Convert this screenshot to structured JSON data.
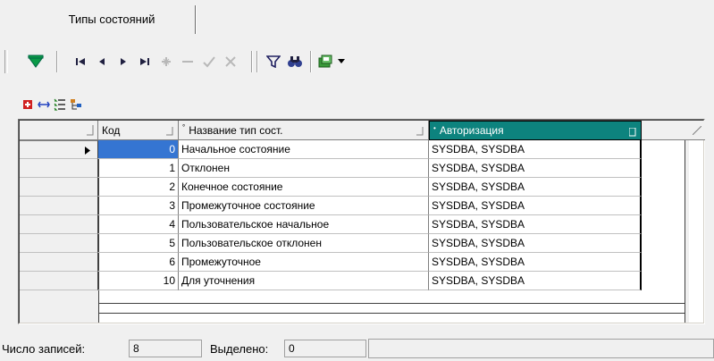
{
  "tab": {
    "label": "Типы состояний"
  },
  "toolbar": {
    "icons": [
      "filter-toggle-icon",
      "first-record-icon",
      "prior-record-icon",
      "next-record-icon",
      "last-record-icon",
      "insert-record-icon",
      "delete-record-icon",
      "post-edit-icon",
      "cancel-edit-icon",
      "filter-icon",
      "find-icon",
      "export-icon",
      "dropdown-arrow-icon"
    ],
    "colors": {
      "accent_green": "#0a9a47",
      "nav_dark": "#202040",
      "disabled": "#b8b8b8"
    }
  },
  "mini_toolbar": {
    "icons": [
      "add-icon",
      "link-icon",
      "list-icon",
      "hierarchy-icon"
    ]
  },
  "grid": {
    "columns": [
      {
        "key": "code",
        "label": "Код"
      },
      {
        "key": "name",
        "label": "Название тип сост."
      },
      {
        "key": "auth",
        "label": "Авторизация"
      }
    ],
    "rows": [
      {
        "code": "0",
        "name": "Начальное состояние",
        "auth": "SYSDBA, SYSDBA"
      },
      {
        "code": "1",
        "name": "Отклонен",
        "auth": "SYSDBA, SYSDBA"
      },
      {
        "code": "2",
        "name": "Конечное состояние",
        "auth": "SYSDBA, SYSDBA"
      },
      {
        "code": "3",
        "name": "Промежуточное состояние",
        "auth": "SYSDBA, SYSDBA"
      },
      {
        "code": "4",
        "name": "Пользовательское начальное",
        "auth": "SYSDBA, SYSDBA"
      },
      {
        "code": "5",
        "name": "Пользовательское отклонен",
        "auth": "SYSDBA, SYSDBA"
      },
      {
        "code": "6",
        "name": "Промежуточное",
        "auth": "SYSDBA, SYSDBA"
      },
      {
        "code": "10",
        "name": "Для уточнения",
        "auth": "SYSDBA, SYSDBA"
      }
    ],
    "active_row": 0,
    "colors": {
      "header_selected": "#0d837e",
      "active_cell": "#3575d2"
    }
  },
  "status": {
    "records_label": "Число записей:",
    "records_value": "8",
    "selected_label": "Выделено:",
    "selected_value": "0"
  }
}
